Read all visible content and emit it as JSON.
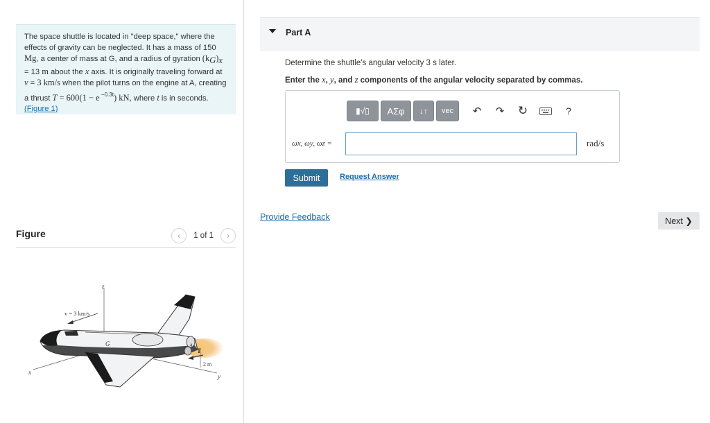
{
  "problem": {
    "s1": "The space shuttle is located in \"deep space,\" where the effects of gravity can be neglected. It has a mass of 150 ",
    "s1_math": "Mg",
    "s2": ", a center of mass at G, and a radius of gyration ",
    "s2_math": "(k",
    "s2_sub": "G",
    "s2_math_b": ")",
    "s2_sub_b": "x",
    "s3": " = 13 ",
    "s3_math": "m",
    "s4": " about the ",
    "s4_math": "x",
    "s5": " axis. It is originally traveling forward at ",
    "s5_math": "v",
    "s6": " = ",
    "s6_math": "3 km/s",
    "s7": " when the pilot turns on the engine at A, creating a thrust ",
    "s7_math": "T",
    "s8_math": " = 600(1 − e",
    "s8_sup": " −0.3t",
    "s8_math_b": ") kN,",
    "s9": " where ",
    "s9_math": "t",
    "s10": " is in seconds.",
    "figure_link": "(Figure 1)"
  },
  "figure": {
    "title": "Figure",
    "count": "1 of 1",
    "prev_icon": "chevron-left-icon",
    "next_icon": "chevron-right-icon",
    "labels": {
      "z": "z",
      "v": "v = 3 km/s",
      "G": "G",
      "A": "A",
      "T": "T",
      "dist": "2 m",
      "x": "x",
      "y": "y"
    }
  },
  "part": {
    "title": "Part A",
    "question": "Determine the shuttle's angular velocity 3 s later.",
    "instr_1": "Enter the ",
    "instr_x": "x",
    "instr_2": ", ",
    "instr_y": "y",
    "instr_3": ", and ",
    "instr_z": "z",
    "instr_4": " components of the angular velocity separated by commas."
  },
  "toolbar": {
    "template": "▮√▯",
    "greek": "ΑΣφ",
    "arrows": "↓↑",
    "vec": "vec",
    "undo": "↶",
    "redo": "↷",
    "reset": "↻",
    "help": "?"
  },
  "answer": {
    "label": "ωx, ωy, ωz =",
    "value": "",
    "unit": "rad/s"
  },
  "actions": {
    "submit": "Submit",
    "request": "Request Answer",
    "feedback": "Provide Feedback",
    "next": "Next ❯"
  },
  "colors": {
    "problem_bg": "#e9f5f7",
    "link": "#1a6fb3",
    "submit": "#2d6f97",
    "toolbar_btn": "#8e9499"
  }
}
